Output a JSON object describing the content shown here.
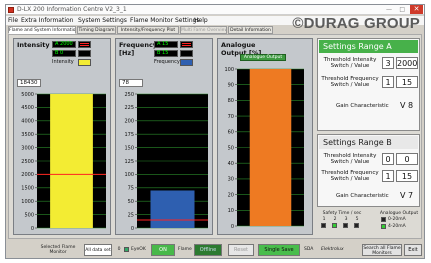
{
  "window": {
    "title": "D-LX 200 Information Centre V2_3_1",
    "logo": "©DURAG GROUP",
    "controls": {
      "minimize": "—",
      "maximize": "□",
      "close": "✕"
    }
  },
  "menu": [
    "File",
    "Extra Information",
    "System Settings",
    "Flame Monitor Settings",
    "Help"
  ],
  "tabs": [
    {
      "label": "Flame and System Information",
      "active": true,
      "enabled": true
    },
    {
      "label": "Timing Diagram",
      "active": false,
      "enabled": true
    },
    {
      "label": "Intensity/Frequency Plot",
      "active": false,
      "enabled": true
    },
    {
      "label": "Multi Fame Overview",
      "active": false,
      "enabled": false
    },
    {
      "label": "Detail Information",
      "active": false,
      "enabled": true
    }
  ],
  "intensity": {
    "title": "Intensity",
    "legend": [
      {
        "label": "A  2000",
        "color": "#00ff00",
        "icon": "double-line-red-icon"
      },
      {
        "label": "B  0",
        "color": "#00ff00",
        "icon": "wave-yellow-icon"
      },
      {
        "label": "Intensity",
        "color": "#000000",
        "icon": "bar-yellow-icon"
      }
    ],
    "value": "18430",
    "axis": {
      "max": 5000,
      "min": 0,
      "step": 500,
      "ticks": [
        "5000",
        "4500",
        "4000",
        "3500",
        "3000",
        "2500",
        "2000",
        "1500",
        "1000",
        "500",
        "0"
      ]
    },
    "bar_value": 5000,
    "threshold": 2000,
    "bar_color": "#f3ec33"
  },
  "frequency": {
    "title": "Frequency",
    "unit": "[Hz]",
    "legend": [
      {
        "label": "A  15",
        "color": "#00ff00",
        "icon": "double-line-red-icon"
      },
      {
        "label": "B  15",
        "color": "#00ff00",
        "icon": "wave-yellow-icon"
      },
      {
        "label": "Frequency",
        "color": "#000000",
        "icon": "bar-blue-icon"
      }
    ],
    "value": "78",
    "axis": {
      "max": 250,
      "min": 0,
      "step": 25,
      "ticks": [
        "250",
        "225",
        "200",
        "175",
        "150",
        "125",
        "100",
        "75",
        "50",
        "25",
        "0"
      ]
    },
    "bar_value": 70,
    "threshold": 15,
    "bar_color": "#2e5fb0"
  },
  "analogue": {
    "title": "Analogue Output [%]",
    "button": "Analogue Output",
    "axis": {
      "max": 100,
      "min": 0,
      "step": 10,
      "ticks": [
        "100",
        "90",
        "80",
        "70",
        "60",
        "50",
        "40",
        "30",
        "20",
        "10",
        "0"
      ]
    },
    "bar_value": 100,
    "bar_color": "#ee7a22"
  },
  "settings_a": {
    "title": "Settings Range A",
    "threshold_intensity_label": "Threshold Intensity Switch / Value",
    "threshold_intensity_switch": "3",
    "threshold_intensity_value": "2000",
    "threshold_frequency_label": "Threshold Frequency Switch / Value",
    "threshold_frequency_switch": "1",
    "threshold_frequency_value": "15",
    "gain_label": "Gain Characteristic",
    "gain_value": "V 8"
  },
  "settings_b": {
    "title": "Settings Range B",
    "threshold_intensity_label": "Threshold Intensity Switch / Value",
    "threshold_intensity_switch": "0",
    "threshold_intensity_value": "0",
    "threshold_frequency_label": "Threshold Frequency Switch / Value",
    "threshold_frequency_switch": "1",
    "threshold_frequency_value": "15",
    "gain_label": "Gain Characteristic",
    "gain_value": "V 7"
  },
  "indicators": {
    "safety_time": "Safety Time / sec",
    "safety_values": [
      "1",
      "2",
      "3",
      "5"
    ],
    "analogue_output": "Analogue Output",
    "analogue_options": [
      "0-20mA",
      "4-20mA"
    ]
  },
  "bottom": {
    "selected_flame_monitor_label": "Selected Flame Monitor",
    "selected_flame_monitor_value": "All data set",
    "count": "0",
    "eyeok": "EyeOK",
    "on": "ON",
    "flame": "Flame",
    "offline": "Offline",
    "reset": "Reset",
    "single_save_mode": "Single Save Mode",
    "sda": "SDA",
    "brand": "Elektrolux",
    "search_label": "Search all Flame Monitors",
    "exit": "Exit"
  }
}
